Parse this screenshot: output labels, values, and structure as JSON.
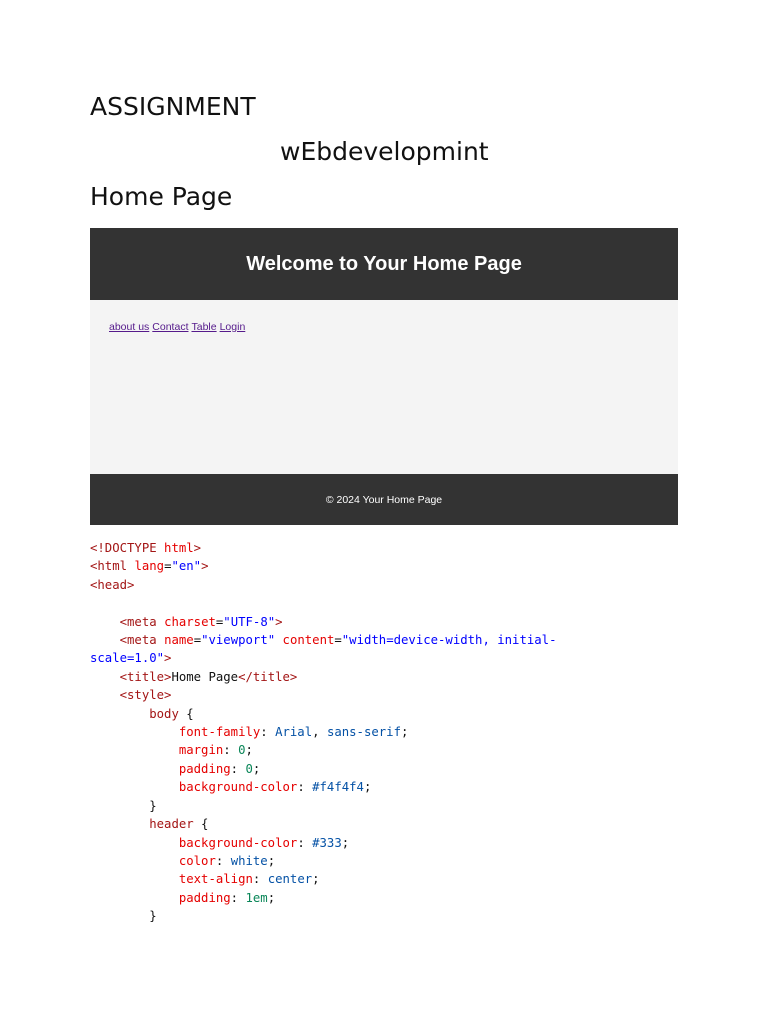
{
  "doc": {
    "title": "ASSIGNMENT",
    "subtitle": "wEbdevelopmint",
    "section": "Home Page"
  },
  "screenshot": {
    "header_text": "Welcome to Your Home Page",
    "nav_links": [
      "about us",
      "Contact",
      "Table",
      "Login"
    ],
    "footer_text": "© 2024 Your Home Page",
    "colors": {
      "header_bg": "#333333",
      "body_bg": "#f4f4f4",
      "link": "#551a8b"
    }
  },
  "code": {
    "doctype_tag": "<!DOCTYPE",
    "doctype_word": "html",
    "html_open": "<html",
    "lang_attr": "lang",
    "lang_val": "\"en\"",
    "head_open": "<head>",
    "meta": "<meta",
    "charset_attr": "charset",
    "charset_val": "\"UTF-8\"",
    "name_attr": "name",
    "name_val": "\"viewport\"",
    "content_attr": "content",
    "content_val_1": "\"width=device-width, initial-",
    "content_val_2": "scale=1.0\"",
    "title_open": "<title>",
    "title_text": "Home Page",
    "title_close": "</title>",
    "style_open": "<style>",
    "sel_body": "body",
    "sel_header": "header",
    "p_font_family": "font-family",
    "v_arial": "Arial",
    "v_sans": "sans-serif",
    "p_margin": "margin",
    "p_padding": "padding",
    "v_zero": "0",
    "p_bg": "background-color",
    "v_f4": "#f4f4f4",
    "v_333": "#333",
    "p_color": "color",
    "v_white": "white",
    "p_text_align": "text-align",
    "v_center": "center",
    "v_1em": "1em"
  }
}
